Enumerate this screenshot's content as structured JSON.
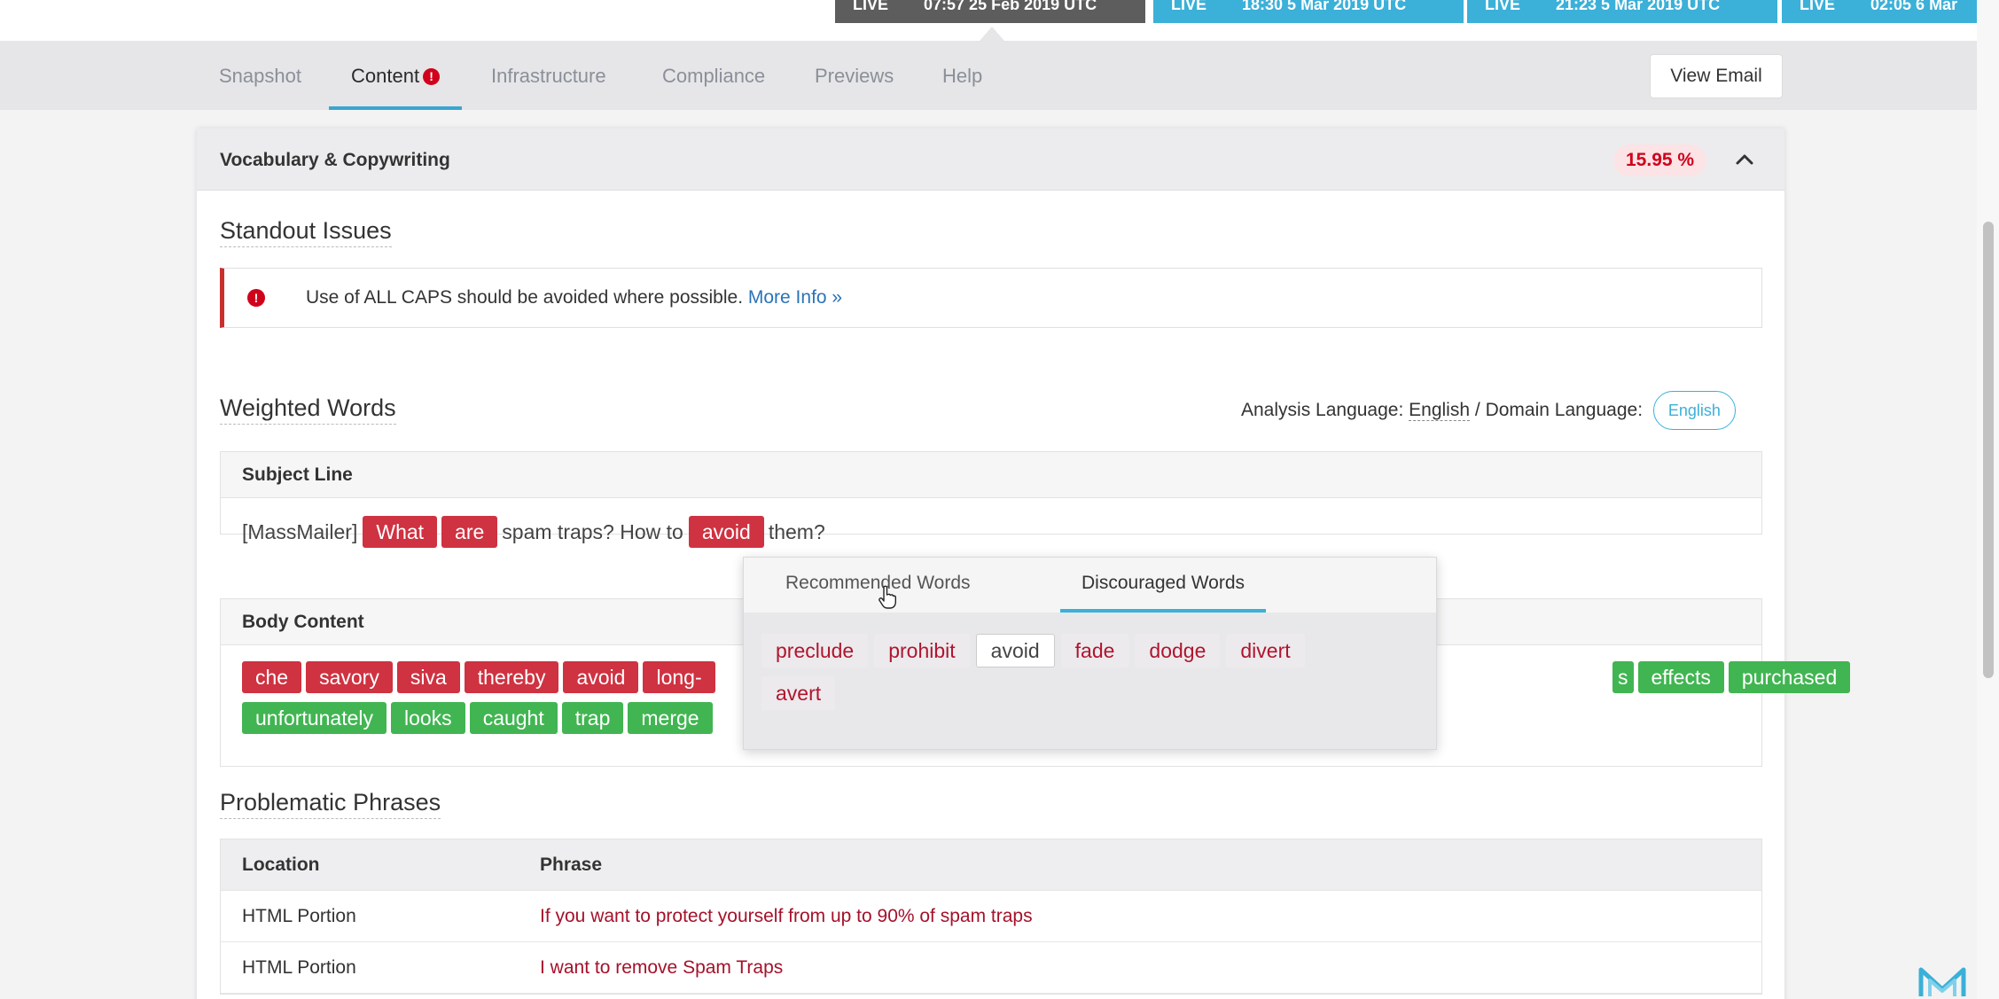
{
  "live_badges": [
    {
      "label": "LIVE",
      "time": "07:57 25 Feb 2019 UTC",
      "style": "dark"
    },
    {
      "label": "LIVE",
      "time": "18:30 5 Mar 2019 UTC",
      "style": "blue"
    },
    {
      "label": "LIVE",
      "time": "21:23 5 Mar 2019 UTC",
      "style": "blue"
    },
    {
      "label": "LIVE",
      "time": "02:05 6 Mar",
      "style": "blue"
    }
  ],
  "nav": {
    "tabs": [
      "Snapshot",
      "Content",
      "Infrastructure",
      "Compliance",
      "Previews",
      "Help"
    ],
    "active_tab": "Content",
    "alert_glyph": "!",
    "view_email": "View Email"
  },
  "card": {
    "title": "Vocabulary & Copywriting",
    "score": "15.95 %"
  },
  "standout": {
    "title": "Standout Issues",
    "icon_glyph": "!",
    "issue_text": "Use of ALL CAPS should be avoided where possible.",
    "more_info": "More Info »"
  },
  "weighted": {
    "title": "Weighted Words",
    "analysis_label": "Analysis Language:",
    "analysis_value": "English",
    "separator": " / ",
    "domain_label": "Domain Language:",
    "domain_value": "English"
  },
  "subject_line": {
    "header": "Subject Line",
    "tokens": [
      {
        "text": "[MassMailer]",
        "kind": "plain"
      },
      {
        "text": "What",
        "kind": "red"
      },
      {
        "text": "are",
        "kind": "red"
      },
      {
        "text": "spam traps? How to",
        "kind": "plain"
      },
      {
        "text": "avoid",
        "kind": "red"
      },
      {
        "text": "them?",
        "kind": "plain"
      }
    ]
  },
  "body_content": {
    "header": "Body Content",
    "row1_left": [
      {
        "text": "che",
        "kind": "red"
      },
      {
        "text": "savory",
        "kind": "red"
      },
      {
        "text": "siva",
        "kind": "red"
      },
      {
        "text": "thereby",
        "kind": "red"
      },
      {
        "text": "avoid",
        "kind": "red"
      },
      {
        "text": "long-",
        "kind": "red"
      }
    ],
    "row1_right": [
      {
        "text": "s",
        "kind": "green"
      },
      {
        "text": "effects",
        "kind": "green"
      },
      {
        "text": "purchased",
        "kind": "green"
      }
    ],
    "row2": [
      {
        "text": "unfortunately",
        "kind": "green"
      },
      {
        "text": "looks",
        "kind": "green"
      },
      {
        "text": "caught",
        "kind": "green"
      },
      {
        "text": "trap",
        "kind": "green"
      },
      {
        "text": "merge",
        "kind": "green"
      }
    ]
  },
  "popover": {
    "tabs": [
      "Recommended Words",
      "Discouraged Words"
    ],
    "active_tab": "Discouraged Words",
    "words": [
      "preclude",
      "prohibit",
      "avoid",
      "fade",
      "dodge",
      "divert",
      "avert"
    ],
    "selected_word": "avoid"
  },
  "phrases": {
    "title": "Problematic Phrases",
    "columns": [
      "Location",
      "Phrase"
    ],
    "rows": [
      {
        "location": "HTML Portion",
        "phrase": "If you want to protect yourself from up to 90% of spam traps"
      },
      {
        "location": "HTML Portion",
        "phrase": "I want to remove Spam Traps"
      }
    ]
  },
  "colors": {
    "accent": "#3bb0d8",
    "danger": "#cf3241",
    "success": "#41b552",
    "score": "#d0021b"
  },
  "icons": [
    "alert-circle-icon",
    "chevron-up-icon",
    "hand-pointer-icon",
    "m-logo-icon"
  ]
}
